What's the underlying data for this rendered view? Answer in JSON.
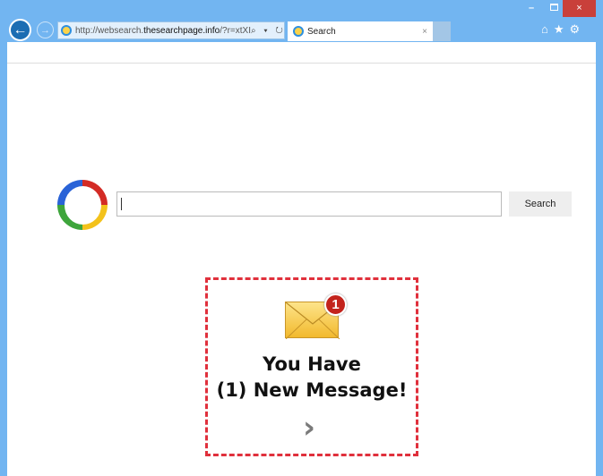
{
  "browser": {
    "url_prefix": "http://websearch.",
    "url_domain": "thesearchpage.info",
    "url_suffix": "/?r=xtXI",
    "address_controls": "⌕ ▾ ↻",
    "tab_title": "Search",
    "tab_close": "×",
    "back": "←",
    "forward": "→",
    "home": "⌂",
    "favorites": "★",
    "settings": "⚙",
    "minimize": "–",
    "close": "×"
  },
  "search": {
    "value": "",
    "button_label": "Search"
  },
  "promo": {
    "badge_count": "1",
    "line1": "You Have",
    "line2": "(1) New Message!",
    "arrow": "›"
  },
  "colors": {
    "frame": "#72b5f1",
    "close": "#c9403a",
    "dash": "#e0303c",
    "badge": "#c3231c"
  }
}
